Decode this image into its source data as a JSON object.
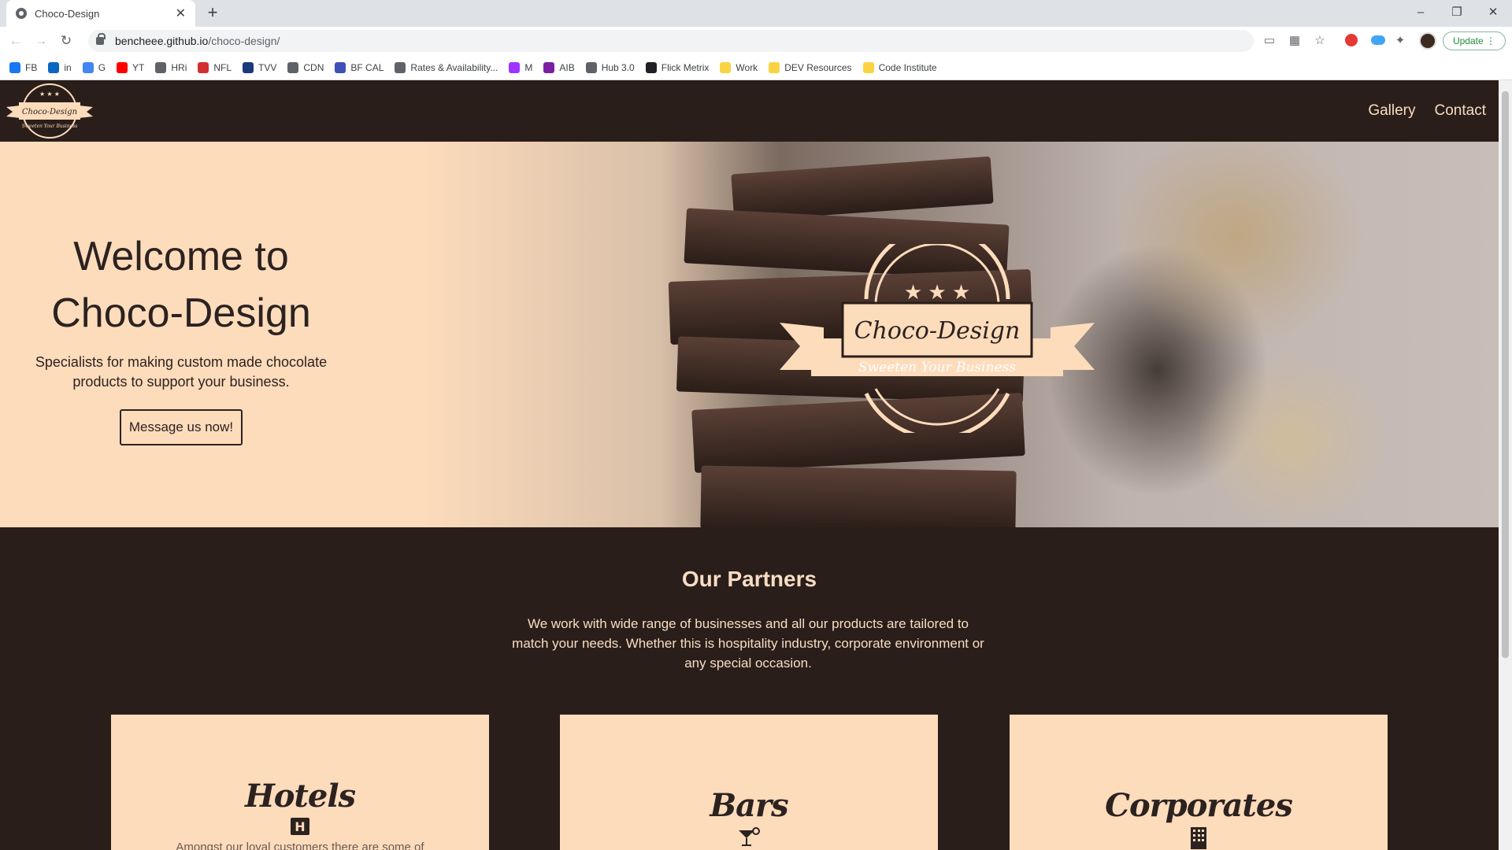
{
  "browser": {
    "tab_title": "Choco-Design",
    "new_tab": "+",
    "url_host": "bencheee.github.io",
    "url_path": "/choco-design/",
    "update_label": "Update",
    "bookmarks": [
      {
        "label": "FB",
        "color": "#1877f2"
      },
      {
        "label": "in",
        "color": "#0a66c2"
      },
      {
        "label": "G",
        "color": "#4285f4"
      },
      {
        "label": "YT",
        "color": "#ff0000"
      },
      {
        "label": "HRi",
        "color": "#5f6368"
      },
      {
        "label": "NFL",
        "color": "#d32f2f"
      },
      {
        "label": "TVV",
        "color": "#1a3a7a"
      },
      {
        "label": "CDN",
        "color": "#5f6368"
      },
      {
        "label": "BF CAL",
        "color": "#3f51b5"
      },
      {
        "label": "Rates & Availability...",
        "color": "#5f6368"
      },
      {
        "label": "M",
        "color": "#a033ff"
      },
      {
        "label": "AIB",
        "color": "#7b1fa2"
      },
      {
        "label": "Hub 3.0",
        "color": "#5f6368"
      },
      {
        "label": "Flick Metrix",
        "color": "#202124"
      },
      {
        "label": "Work",
        "color": "#f9d342"
      },
      {
        "label": "DEV Resources",
        "color": "#f9d342"
      },
      {
        "label": "Code Institute",
        "color": "#f9d342"
      }
    ]
  },
  "site": {
    "logo_text": "Choco-Design",
    "logo_tagline": "Sweeten Your Business",
    "nav": [
      "Gallery",
      "Contact"
    ]
  },
  "hero": {
    "title_line1": "Welcome to",
    "title_line2": "Choco-Design",
    "subtitle": "Specialists for making custom made chocolate products to support your business.",
    "cta": "Message us now!",
    "emblem_text": "Choco-Design",
    "emblem_tagline": "Sweeten Your Business"
  },
  "partners": {
    "title": "Our Partners",
    "text": "We work with wide range of businesses and all our products are tailored to match your needs. Whether this is hospitality industry, corporate environment or any special occasion.",
    "cards": [
      {
        "title": "Hotels",
        "icon": "hotel-icon",
        "text": "Amongst our loyal customers there are some of"
      },
      {
        "title": "Bars",
        "icon": "cocktail-icon",
        "text": ""
      },
      {
        "title": "Corporates",
        "icon": "building-icon",
        "text": ""
      }
    ]
  },
  "colors": {
    "brand_dark": "#2a1e1a",
    "brand_peach": "#fddcbc",
    "nav_text": "#f7dcc3"
  }
}
